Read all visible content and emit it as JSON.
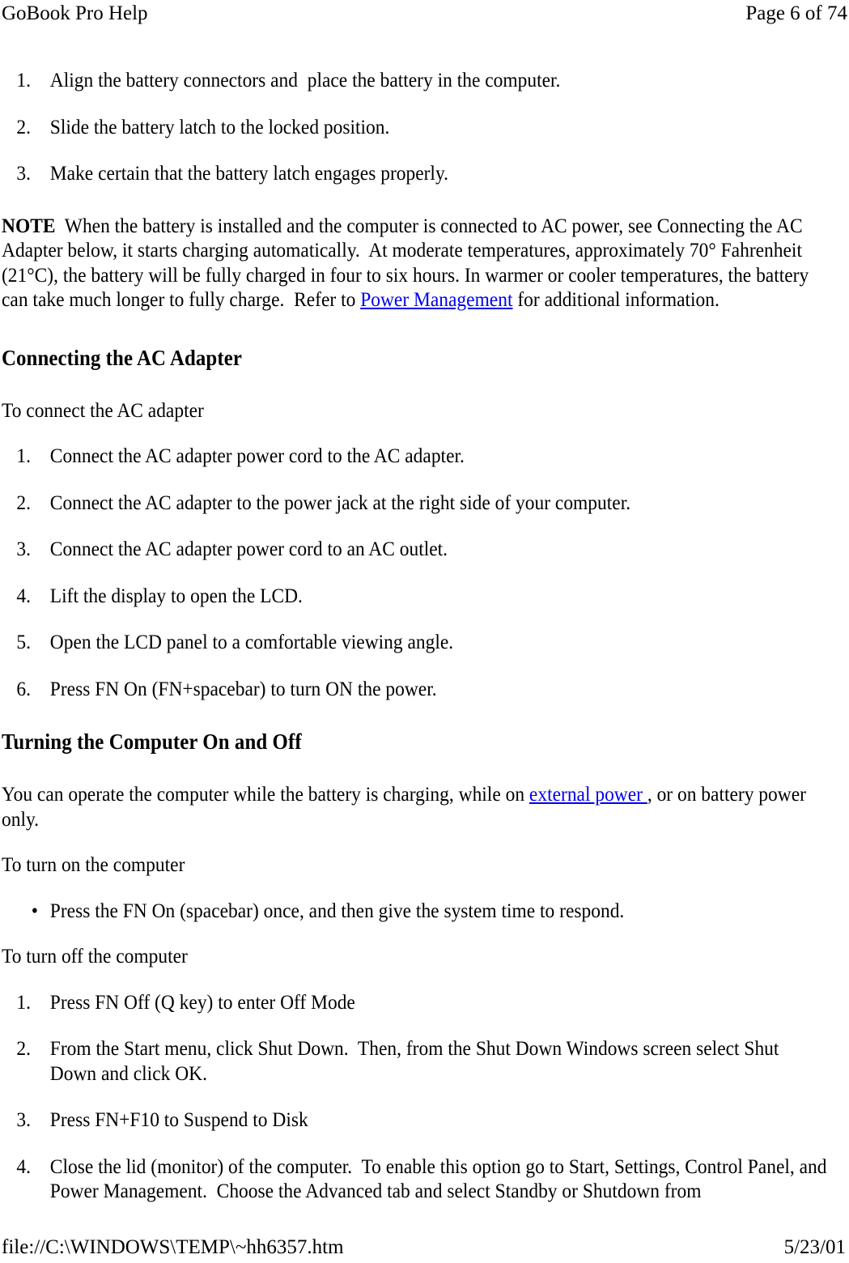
{
  "header": {
    "left": "GoBook Pro Help",
    "right": "Page 6 of 74"
  },
  "footer": {
    "left": "file://C:\\WINDOWS\\TEMP\\~hh6357.htm",
    "right": "5/23/01"
  },
  "colors": {
    "text": "#000000",
    "link": "#0000ee",
    "background": "#ffffff"
  },
  "battery_steps": {
    "markers": [
      "1.",
      "2.",
      "3."
    ],
    "items": [
      "Align the battery connectors and  place the battery in the computer.",
      "Slide the battery latch to the locked position.",
      "Make certain that the battery latch engages properly."
    ]
  },
  "note": {
    "label": "NOTE",
    "text_before_link": "  When the battery is installed and the computer is connected to AC power, see Connecting the AC Adapter below, it starts charging automatically.  At moderate temperatures, approximately 70° Fahrenheit (21°C), the battery will be fully charged in four to six hours. In warmer or cooler temperatures, the battery can take much longer to fully charge.  Refer to ",
    "link_text": "Power Management",
    "text_after_link": " for additional information."
  },
  "ac_adapter_section": {
    "heading": "Connecting the AC Adapter",
    "intro": "To connect the AC adapter",
    "markers": [
      "1.",
      "2.",
      "3.",
      "4.",
      "5.",
      "6."
    ],
    "items": [
      "Connect the AC adapter power cord to the AC adapter.",
      "Connect the AC adapter to the power jack at the right side of your computer.",
      "Connect the AC adapter power cord to an AC outlet.",
      "Lift the display to open the LCD.",
      "Open the LCD panel to a comfortable viewing angle.",
      "Press FN On (FN+spacebar) to turn ON the power."
    ]
  },
  "power_section": {
    "heading": "Turning the Computer On and Off",
    "intro_before_link": "You can operate the computer while the battery is charging, while on ",
    "intro_link_text": "external power ",
    "intro_after_link": ", or on battery power only.",
    "turn_on_label": "To turn on the computer",
    "bullet_marker": "•",
    "turn_on_items": [
      "Press the FN On (spacebar) once, and then give the system time to respond."
    ],
    "turn_off_label": "To turn off the computer",
    "markers": [
      "1.",
      "2.",
      "3.",
      "4."
    ],
    "turn_off_items": [
      "Press FN Off (Q key) to enter Off Mode",
      "From the Start menu, click Shut Down.  Then, from the Shut Down Windows screen select Shut Down and click OK.",
      "Press FN+F10 to Suspend to Disk",
      "Close the lid (monitor) of the computer.  To enable this option go to Start, Settings, Control Panel, and Power Management.  Choose the Advanced tab and select Standby or Shutdown from"
    ]
  }
}
